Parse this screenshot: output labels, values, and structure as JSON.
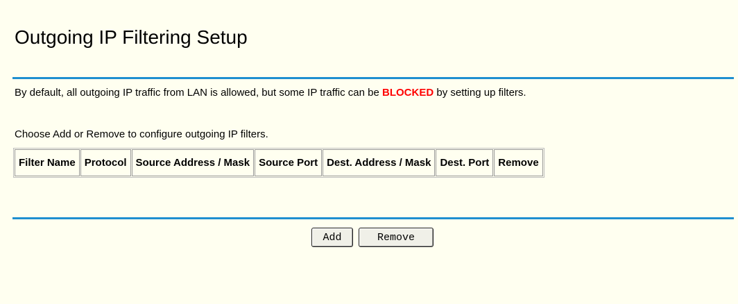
{
  "page": {
    "title": "Outgoing IP Filtering Setup",
    "intro_before": "By default, all outgoing IP traffic from LAN is allowed, but some IP traffic can be ",
    "intro_blocked": "BLOCKED",
    "intro_after": " by setting up filters.",
    "hint": "Choose Add or Remove to configure outgoing IP filters."
  },
  "table": {
    "columns": [
      "Filter Name",
      "Protocol",
      "Source Address / Mask",
      "Source Port",
      "Dest. Address / Mask",
      "Dest. Port",
      "Remove"
    ],
    "rows": []
  },
  "buttons": {
    "add_label": "Add",
    "remove_label": "Remove"
  },
  "colors": {
    "background": "#fffff0",
    "divider": "#1f8fd0",
    "blocked": "#ff0000"
  }
}
